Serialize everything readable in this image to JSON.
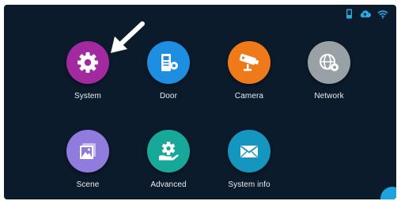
{
  "status_icons": [
    "phone-icon",
    "cloud-icon",
    "wifi-icon"
  ],
  "menu": {
    "items": [
      {
        "label": "System",
        "icon": "gear-icon",
        "color": "#a12aa0"
      },
      {
        "label": "Door",
        "icon": "door-station-icon",
        "color": "#1e8fe0"
      },
      {
        "label": "Camera",
        "icon": "camera-icon",
        "color": "#ef7a1a"
      },
      {
        "label": "Network",
        "icon": "globe-icon",
        "color": "#9aa1a6"
      },
      {
        "label": "Scene",
        "icon": "image-icon",
        "color": "#8f7cdd"
      },
      {
        "label": "Advanced",
        "icon": "hand-sync-icon",
        "color": "#18a89a"
      },
      {
        "label": "System info",
        "icon": "envelope-icon",
        "color": "#1496be"
      }
    ]
  },
  "colors": {
    "screen_background": "#0b1b2b",
    "status_icon": "#2aa8e6",
    "label_text": "#e9eef3"
  }
}
